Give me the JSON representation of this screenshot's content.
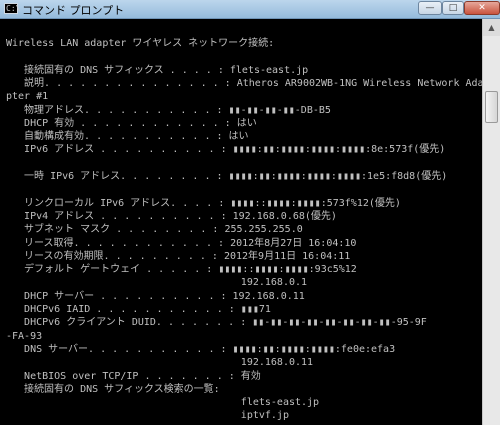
{
  "window": {
    "title": "コマンド プロンプト",
    "icon": "cmd-icon",
    "icon_glyph": "C:\\",
    "minimize_glyph": "—",
    "maximize_glyph": "□",
    "close_glyph": "✕"
  },
  "scrollbar": {
    "up_arrow_glyph": "▲"
  },
  "console_lines": [
    "Wireless LAN adapter ワイヤレス ネットワーク接続:",
    "",
    "   接続固有の DNS サフィックス . . . . : flets-east.jp",
    "   説明. . . . . . . . . . . . . . . : Atheros AR9002WB-1NG Wireless Network Ada",
    "pter #1",
    "   物理アドレス. . . . . . . . . . . : ▮▮-▮▮-▮▮-▮▮-DB-B5",
    "   DHCP 有効 . . . . . . . . . . . . : はい",
    "   自動構成有効. . . . . . . . . . . : はい",
    "   IPv6 アドレス . . . . . . . . . . : ▮▮▮▮:▮▮:▮▮▮▮:▮▮▮▮:▮▮▮▮:8e:573f(優先)",
    "",
    "   一時 IPv6 アドレス. . . . . . . . : ▮▮▮▮:▮▮:▮▮▮▮:▮▮▮▮:▮▮▮▮:1e5:f8d8(優先)",
    "",
    "   リンクローカル IPv6 アドレス. . . . : ▮▮▮▮::▮▮▮▮:▮▮▮▮:573f%12(優先)",
    "   IPv4 アドレス . . . . . . . . . . : 192.168.0.68(優先)",
    "   サブネット マスク . . . . . . . . : 255.255.255.0",
    "   リース取得. . . . . . . . . . . . : 2012年8月27日 16:04:10",
    "   リースの有効期限. . . . . . . . . : 2012年9月11日 16:04:11",
    "   デフォルト ゲートウェイ . . . . . : ▮▮▮▮::▮▮▮▮:▮▮▮▮:93c5%12",
    "                                       192.168.0.1",
    "   DHCP サーバー . . . . . . . . . . : 192.168.0.11",
    "   DHCPv6 IAID . . . . . . . . . . . : ▮▮▮71",
    "   DHCPv6 クライアント DUID. . . . . . . : ▮▮-▮▮-▮▮-▮▮-▮▮-▮▮-▮▮-▮▮-95-9F",
    "-FA-93",
    "   DNS サーバー. . . . . . . . . . . : ▮▮▮▮:▮▮:▮▮▮▮:▮▮▮▮:fe0e:efa3",
    "                                       192.168.0.11",
    "   NetBIOS over TCP/IP . . . . . . . : 有効",
    "   接続固有の DNS サフィックス検索の一覧:",
    "                                       flets-east.jp",
    "                                       iptvf.jp"
  ]
}
